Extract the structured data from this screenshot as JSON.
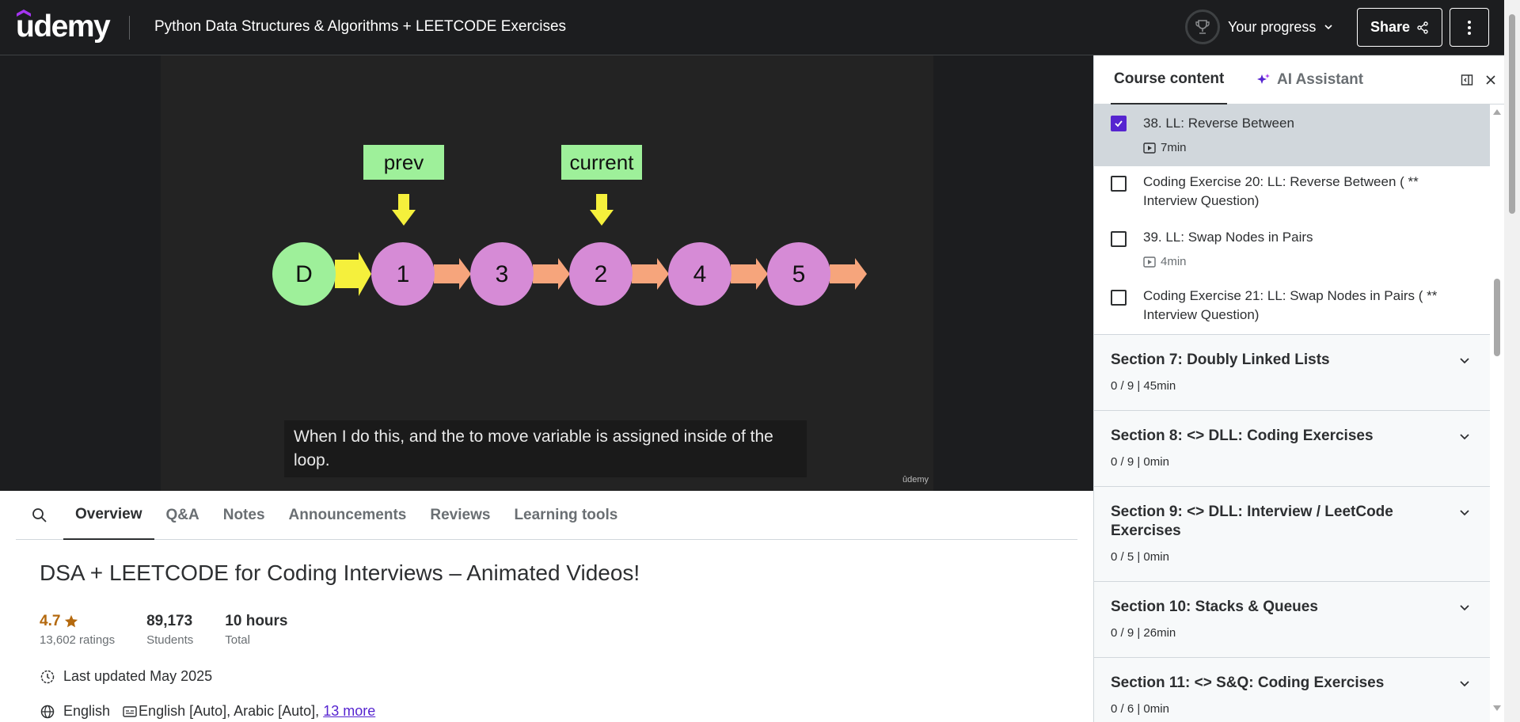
{
  "header": {
    "logo": "udemy",
    "course_title": "Python Data Structures & Algorithms + LEETCODE Exercises",
    "progress_label": "Your progress",
    "share_label": "Share"
  },
  "video": {
    "slide": {
      "labels": [
        "prev",
        "current"
      ],
      "nodes": [
        "D",
        "1",
        "3",
        "2",
        "4",
        "5"
      ]
    },
    "caption": "When I do this, and the to move variable is assigned inside of the loop.",
    "watermark": "ûdemy"
  },
  "tabs": [
    "Overview",
    "Q&A",
    "Notes",
    "Announcements",
    "Reviews",
    "Learning tools"
  ],
  "overview": {
    "title": "DSA + LEETCODE for Coding Interviews – Animated Videos!",
    "rating": "4.7",
    "ratings_count": "13,602 ratings",
    "students": "89,173",
    "students_label": "Students",
    "hours": "10 hours",
    "hours_label": "Total",
    "last_updated": "Last updated May 2025",
    "language": "English",
    "captions": "English [Auto], Arabic [Auto],",
    "more_link": "13 more"
  },
  "sidebar": {
    "tab_course": "Course content",
    "tab_ai": "AI Assistant",
    "lectures": [
      {
        "title": "38. LL: Reverse Between",
        "meta": "7min",
        "checked": true,
        "active": true
      },
      {
        "title": "Coding Exercise 20: LL: Reverse Between ( ** Interview Question)",
        "meta": "",
        "checked": false
      },
      {
        "title": "39. LL: Swap Nodes in Pairs",
        "meta": "4min",
        "checked": false
      },
      {
        "title": "Coding Exercise 21: LL: Swap Nodes in Pairs ( ** Interview Question)",
        "meta": "",
        "checked": false
      }
    ],
    "sections": [
      {
        "title": "Section 7: Doubly Linked Lists",
        "meta": "0 / 9 | 45min"
      },
      {
        "title": "Section 8: <> DLL: Coding Exercises",
        "meta": "0 / 9 | 0min"
      },
      {
        "title": "Section 9: <> DLL: Interview / LeetCode Exercises",
        "meta": "0 / 5 | 0min"
      },
      {
        "title": "Section 10: Stacks & Queues",
        "meta": "0 / 9 | 26min"
      },
      {
        "title": "Section 11: <> S&Q: Coding Exercises",
        "meta": "0 / 6 | 0min"
      }
    ]
  },
  "colors": {
    "accent": "#5624d0",
    "header_bg": "#1c1d1f",
    "node_pink": "#d68bd6",
    "node_green": "#9ef09a",
    "arrow_yellow": "#f5f03c",
    "arrow_orange": "#f6a57c",
    "rating": "#b4690e"
  }
}
